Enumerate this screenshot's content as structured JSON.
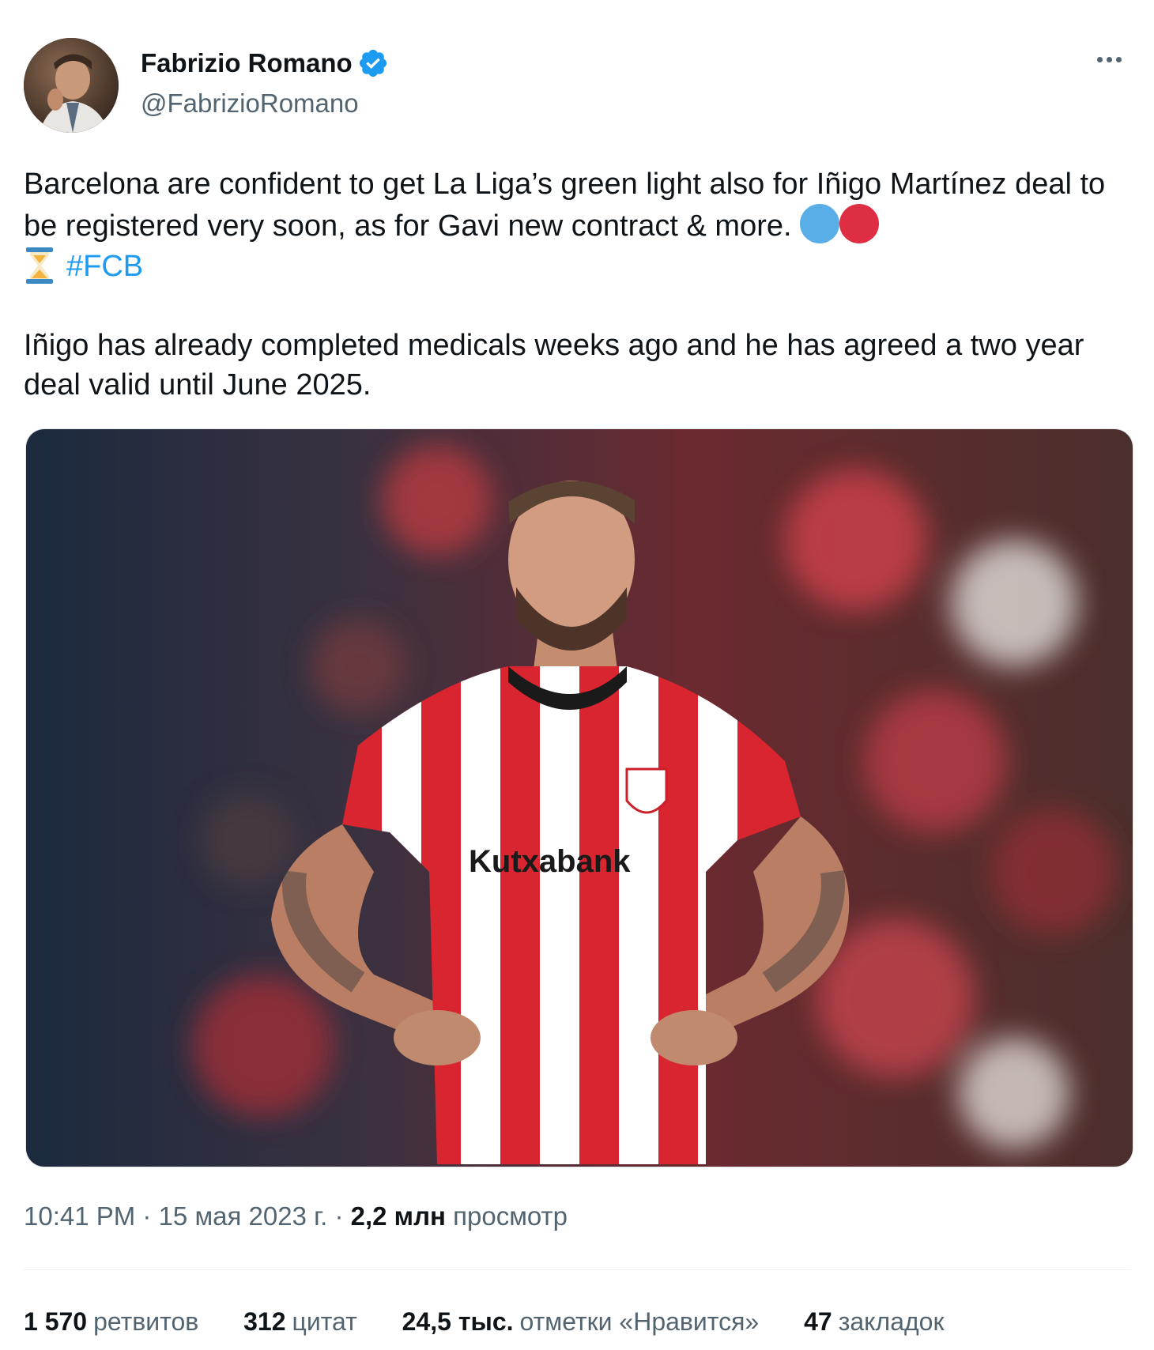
{
  "author": {
    "name": "Fabrizio Romano",
    "handle": "@FabrizioRomano",
    "verified": true
  },
  "tweet": {
    "line1": "Barcelona are confident to get La Liga’s green light also for Iñigo Martínez deal to be registered very soon, as for Gavi new contract & more.",
    "hashtag": "#FCB",
    "paragraph2": "Iñigo has already completed medicals weeks ago and he has agreed a two year deal valid until June 2025.",
    "emoji": [
      "blue-circle",
      "red-circle",
      "hourglass"
    ]
  },
  "media": {
    "alt_icon": "photo-player-red-white-striped-kit",
    "sponsor_text": "Kutxabank"
  },
  "meta": {
    "time": "10:41 PM",
    "sep1": " · ",
    "date": "15 мая 2023 г.",
    "sep2": " · ",
    "views_count": "2,2 млн",
    "views_label": "просмотр"
  },
  "stats": {
    "retweets_count": "1 570",
    "retweets_label": "ретвитов",
    "quotes_count": "312",
    "quotes_label": "цитат",
    "likes_count": "24,5 тыс.",
    "likes_label": "отметки «Нравится»",
    "bookmarks_count": "47",
    "bookmarks_label": "закладок"
  },
  "colors": {
    "link": "#1d9bf0",
    "secondary_text": "#536471",
    "primary_text": "#0f1419",
    "verified_badge": "#1d9bf0"
  }
}
